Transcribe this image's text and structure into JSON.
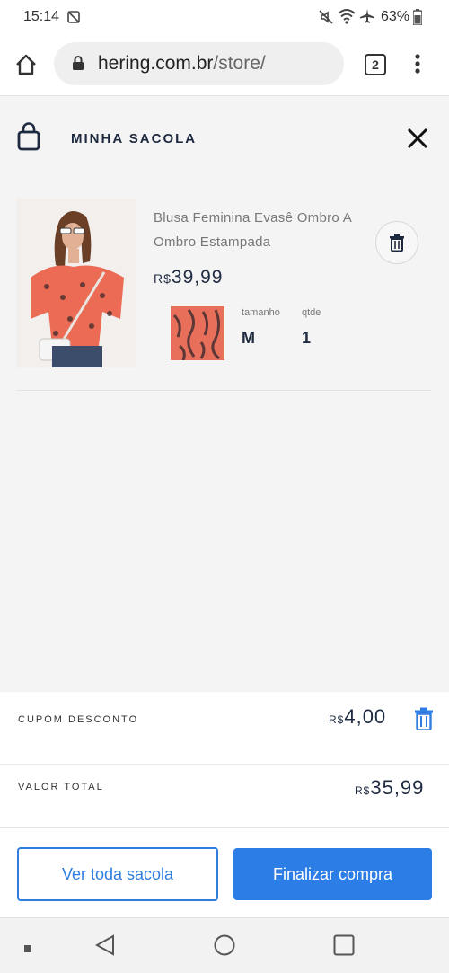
{
  "status_bar": {
    "time": "15:14",
    "battery": "63%"
  },
  "browser": {
    "url_domain": "hering.com.br",
    "url_path": "/store/",
    "tab_count": "2"
  },
  "cart": {
    "title": "MINHA SACOLA"
  },
  "product": {
    "name": "Blusa Feminina Evasê Ombro A Ombro Estampada",
    "price_currency": "R$",
    "price_value": "39,99",
    "size_label": "tamanho",
    "size_value": "M",
    "qty_label": "qtde",
    "qty_value": "1"
  },
  "coupon": {
    "label": "CUPOM DESCONTO",
    "currency": "R$",
    "value": "4,00"
  },
  "total": {
    "label": "VALOR TOTAL",
    "currency": "R$",
    "value": "35,99"
  },
  "actions": {
    "view_all": "Ver toda sacola",
    "checkout": "Finalizar compra"
  },
  "colors": {
    "accent": "#2c7ee6",
    "text_dark": "#1e2a40",
    "panel_bg": "#f4f4f4"
  }
}
